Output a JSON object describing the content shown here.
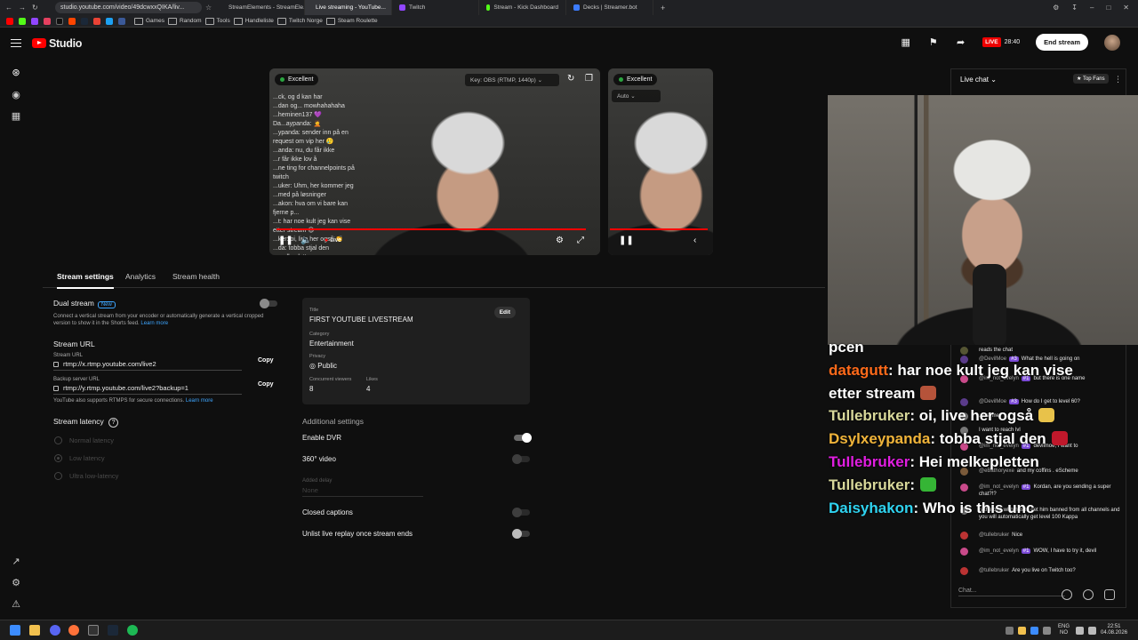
{
  "browser": {
    "url": "studio.youtube.com/video/49dcwxxQIKA/liv...",
    "tabs": [
      {
        "label": "StreamElements - StreamEle...",
        "color": "#8a5cff",
        "active": false
      },
      {
        "label": "Live streaming - YouTube...",
        "color": "#ff0000",
        "active": true
      },
      {
        "label": "Twitch",
        "color": "#9146ff",
        "active": false
      },
      {
        "label": "Stream - Kick Dashboard",
        "color": "#53fc18",
        "active": false
      },
      {
        "label": "Decks | Streamer.bot",
        "color": "#3c7cff",
        "active": false
      }
    ],
    "bookmarks": [
      "Games",
      "Random",
      "Tools",
      "Handleliste",
      "Twitch Norge",
      "Steam Roulette"
    ]
  },
  "header": {
    "logo_text": "Studio",
    "live_label": "LIVE",
    "live_time": "28:40",
    "end_stream": "End stream"
  },
  "player_main": {
    "status": "Excellent",
    "key_select": "Key: OBS (RTMP, 1440p)",
    "live_label": "Live",
    "chat_overlay": [
      "...ck, og d kan har",
      "...dan og... mowhahahaha",
      "...heminen137 💜",
      "Da...aypanda: 🤦",
      "...ypanda: sender inn på en",
      "request om vip her 🥲",
      "...anda: nu, du får ikke",
      "...r får ikke lov å",
      "...ne ting for channelpoints på",
      "twitch",
      "...uker: Uhm, her kommer jeg",
      "...med på løsninger",
      "...akon: hva om vi bare kan",
      "fjerne p...",
      "...t: har noe kult jeg kan vise",
      "etter stream 😊",
      "...ker: oi, live her også 👏",
      "...da: tobba stjal den",
      "...melkepletten"
    ]
  },
  "player_vertical": {
    "status": "Excellent",
    "select": "Auto"
  },
  "tabs": [
    "Stream settings",
    "Analytics",
    "Stream health"
  ],
  "settings": {
    "dual_stream_label": "Dual stream",
    "new_tag": "New",
    "dual_desc": "Connect a vertical stream from your encoder or automatically generate a vertical cropped version to show it in the Shorts feed.",
    "learn_more": "Learn more",
    "stream_url_title": "Stream URL",
    "stream_url_label": "Stream URL",
    "stream_url": "rtmp://x.rtmp.youtube.com/live2",
    "backup_label": "Backup server URL",
    "backup_url": "rtmp://y.rtmp.youtube.com/live2?backup=1",
    "copy": "Copy",
    "rtmps_note": "YouTube also supports RTMPS for secure connections.",
    "latency_title": "Stream latency",
    "latency_options": [
      "Normal latency",
      "Low latency",
      "Ultra low-latency"
    ]
  },
  "card": {
    "title_label": "Title",
    "title": "FIRST YOUTUBE LIVESTREAM",
    "category_label": "Category",
    "category": "Entertainment",
    "privacy_label": "Privacy",
    "privacy": "Public",
    "viewers_label": "Concurrent viewers",
    "viewers": "8",
    "likes_label": "Likes",
    "likes": "4",
    "edit": "Edit"
  },
  "additional": {
    "title": "Additional settings",
    "dvr": "Enable DVR",
    "video360": "360° video",
    "delay_label": "Added delay",
    "delay_value": "None",
    "captions": "Closed captions",
    "unlist": "Unlist live replay once stream ends"
  },
  "overlay_chat": [
    {
      "user": "",
      "user_color": "#ffffff",
      "text": "pcen",
      "emote": ""
    },
    {
      "user": "datagutt",
      "user_color": "#ff6a1a",
      "text": ": har noe kult jeg kan vise",
      "emote": ""
    },
    {
      "user": "",
      "user_color": "#ffffff",
      "text": "etter stream",
      "emote": "#b5533a"
    },
    {
      "user": "Tullebruker",
      "user_color": "#d8d89a",
      "text": ": oi, live her også",
      "emote": "#e8c24a"
    },
    {
      "user": "Dsylxeypanda",
      "user_color": "#f0b43a",
      "text": ": tobba stjal den",
      "emote": "#c0182b"
    },
    {
      "user": "TuIlebruker",
      "user_color": "#e01ee0",
      "text": ": Hei melkepletten",
      "emote": ""
    },
    {
      "user": "Tullebruker",
      "user_color": "#d8d89a",
      "text": ":",
      "emote": "#35b535"
    },
    {
      "user": "Daisyhakon",
      "user_color": "#2fd3f0",
      "text": ": Who is this unc",
      "emote": ""
    }
  ],
  "live_chat": {
    "title": "Live chat",
    "top_fans": "Top Fans",
    "input_placeholder": "Chat...",
    "messages": [
      {
        "user": "",
        "badge": "",
        "text": "reads the chat"
      },
      {
        "user": "@DevilMoe",
        "badge": "#3",
        "text": "What the hell is going on"
      },
      {
        "user": "@im_not_evelyn",
        "badge": "#1",
        "text": "but there is one name"
      },
      {
        "user": "@DevilMoe",
        "badge": "#3",
        "text": "How do I get to level 60?"
      },
      {
        "user": "",
        "badge": "",
        "text": "...ost me?"
      },
      {
        "user": "",
        "badge": "",
        "text": "I want to reach lvl"
      },
      {
        "user": "@im_not_evelyn",
        "badge": "#1",
        "text": "devilmoe, I want to"
      },
      {
        "user": "@eBathoryexe",
        "badge": "",
        "text": "and my coffins . eScheme"
      },
      {
        "user": "@im_not_evelyn",
        "badge": "#1",
        "text": "Kordan, are you sending a super chat?!?"
      },
      {
        "user": "",
        "badge": "",
        "text": "is the one who has to get him banned from all channels and you will automatically get level 100 Kappa"
      },
      {
        "user": "@tullebruker",
        "badge": "",
        "text": "Nice"
      },
      {
        "user": "@im_not_evelyn",
        "badge": "#1",
        "text": "WOW, I have to try it, devil"
      },
      {
        "user": "@tullebruker",
        "badge": "",
        "text": "Are you live on Twitch too?"
      }
    ]
  },
  "taskbar": {
    "lang": "ENG",
    "region": "NO",
    "time": "22:51",
    "date": "04.08.2026"
  }
}
